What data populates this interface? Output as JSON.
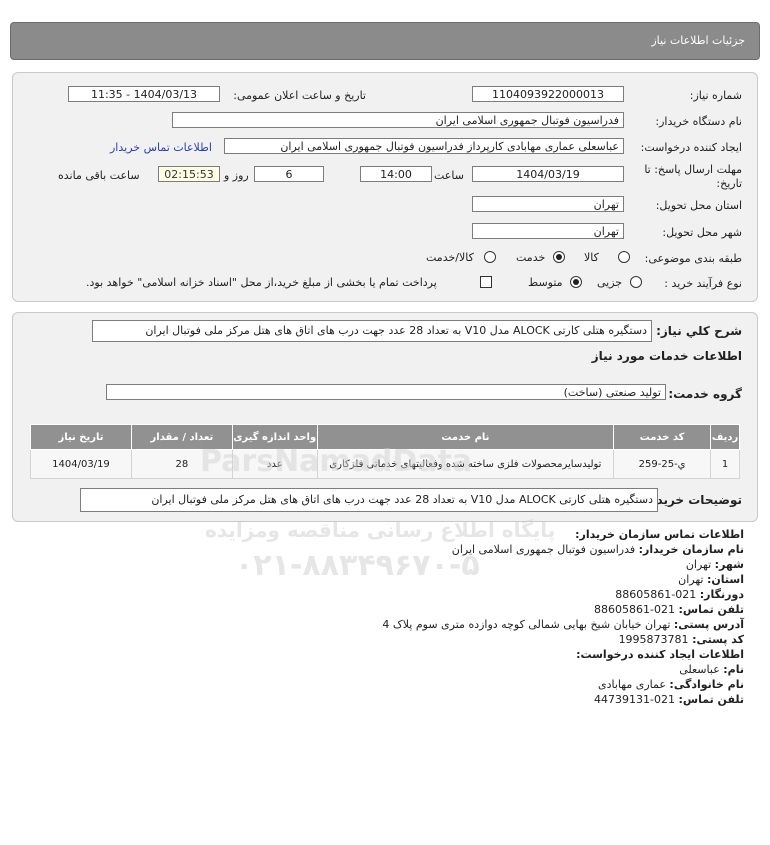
{
  "page_title": "جزئیات اطلاعات نیاز",
  "form": {
    "need_number_label": "شماره نیاز:",
    "need_number": "1104093922000013",
    "announce_label": "تاریخ و ساعت اعلان عمومی:",
    "announce_value": "1404/03/13 - 11:35",
    "buyer_org_label": "نام دستگاه خریدار:",
    "buyer_org": "فدراسیون فوتبال جمهوری اسلامی ایران",
    "creator_label": "ایجاد کننده درخواست:",
    "creator": "عباسعلی عماری مهابادی کارپرداز فدراسیون فوتبال جمهوری اسلامی ایران",
    "contact_link": "اطلاعات تماس خریدار",
    "deadline_label_1": "مهلت ارسال پاسخ: تا",
    "deadline_label_2": "تاریخ:",
    "deadline_date": "1404/03/19",
    "time_label": "ساعت",
    "deadline_time": "14:00",
    "days_value": "6",
    "days_label": "روز و",
    "remaining_value": "02:15:53",
    "remaining_label": "ساعت باقی مانده",
    "province_label": "استان محل تحویل:",
    "province": "تهران",
    "city_label": "شهر محل تحویل:",
    "city": "تهران",
    "category_label": "طبقه بندی موضوعی:",
    "category_goods": "کالا",
    "category_service": "خدمت",
    "category_both": "کالا/خدمت",
    "category_selected": "خدمت",
    "process_label": "نوع فرآیند خرید :",
    "process_partial": "جزیی",
    "process_medium": "متوسط",
    "process_selected": "متوسط",
    "payment_note": "پرداخت تمام یا بخشی از مبلغ خرید،از محل \"اسناد خزانه اسلامی\" خواهد بود."
  },
  "summary": {
    "label": "شرح کلي نياز:",
    "text": "دستگیره هتلی کارتی ALOCK مدل V10 به تعداد 28 عدد جهت درب های اتاق های هتل مرکز ملی فوتبال ایران",
    "services_heading": "اطلاعات خدمات مورد نیاز",
    "service_group_label": "گروه خدمت:",
    "service_group": "تولید صنعتی (ساخت)"
  },
  "table": {
    "headers": [
      "ردیف",
      "کد خدمت",
      "نام خدمت",
      "واحد اندازه گیری",
      "تعداد / مقدار",
      "تاریخ نیاز"
    ],
    "rows": [
      [
        "1",
        "ي-25-259",
        "تولیدسایرمحصولات فلزی ساخته شده وفعالیتهای خدماتی فلزکاری",
        "عدد",
        "28",
        "1404/03/19"
      ]
    ]
  },
  "buyer_notes": {
    "label": "توضیحات خریدار:",
    "text": "دستگیره هتلی کارتی ALOCK مدل V10 به تعداد 28 عدد جهت درب های اتاق های هتل مرکز ملی فوتبال ایران"
  },
  "contact": {
    "heading": "اطلاعات تماس سازمان خریدار:",
    "org_label": "نام سازمان خریدار:",
    "org_value": "فدراسیون فوتبال جمهوری اسلامی ایران",
    "city_label": "شهر:",
    "city_value": "تهران",
    "province_label": "استان:",
    "province_value": "تهران",
    "fax_label": "دورنگار:",
    "fax_value": "021-88605861",
    "phone_label": "تلفن تماس:",
    "phone_value": "021-88605861",
    "address_label": "آدرس پستی:",
    "address_value": "تهران خیابان شیخ بهایی شمالی کوچه دوازده متری سوم پلاک 4",
    "postal_label": "کد پستی:",
    "postal_value": "1995873781",
    "creator_heading": "اطلاعات ایجاد کننده درخواست:",
    "name_label": "نام:",
    "name_value": "عباسعلی",
    "family_label": "نام خانوادگی:",
    "family_value": "عماری مهابادی",
    "creator_phone_label": "تلفن تماس:",
    "creator_phone_value": "021-44739131"
  },
  "watermark": {
    "line1": "ParsNamadData",
    "line2": "پایگاه اطلاع رسانی مناقصه ومزایده",
    "line3": "۰۲۱-۸۸۳۴۹۶۷۰-۵"
  }
}
